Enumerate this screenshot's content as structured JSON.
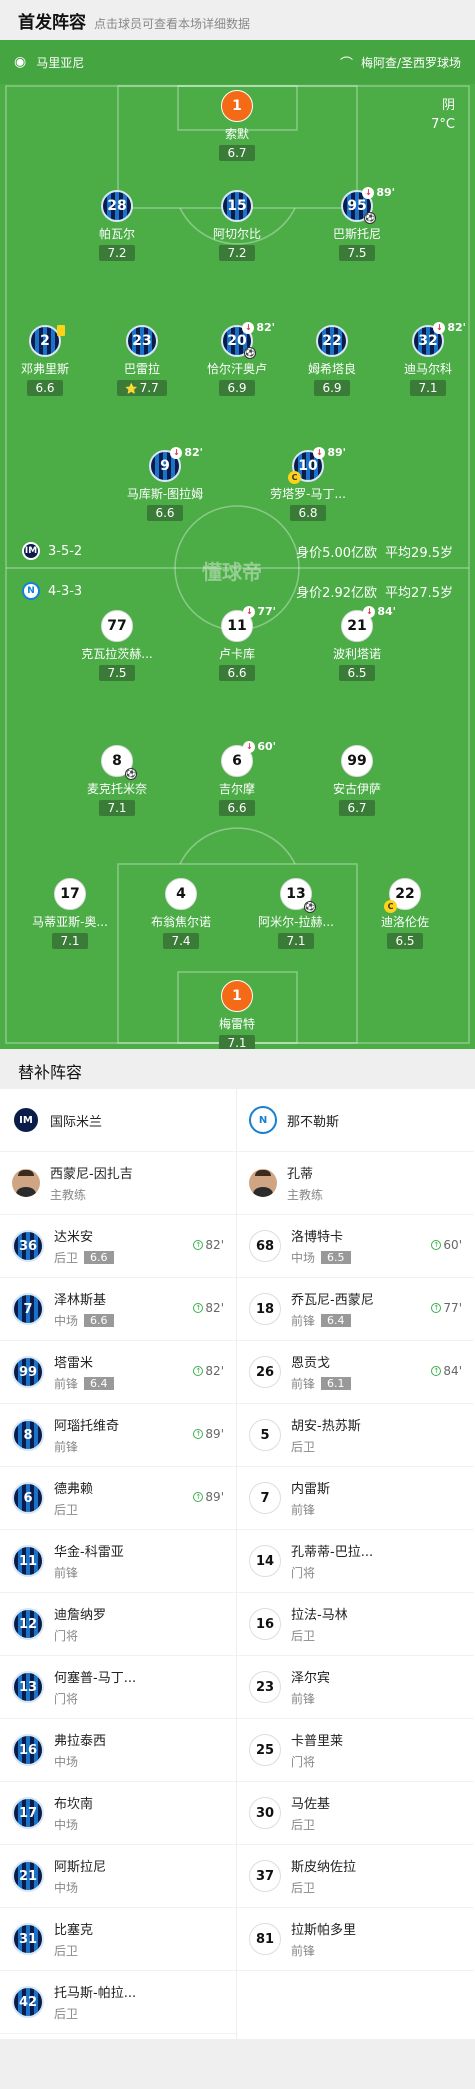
{
  "header": {
    "title": "首发阵容",
    "subtitle": "点击球员可查看本场详细数据"
  },
  "pitch": {
    "referee": "马里亚尼",
    "stadium": "梅阿查/圣西罗球场",
    "weather": "阴",
    "temperature": "7°C",
    "watermark": "懂球帝",
    "home": {
      "formation": "3-5-2",
      "value": "身价5.00亿欧",
      "avg_age": "平均29.5岁"
    },
    "away": {
      "formation": "4-3-3",
      "value": "身价2.92亿欧",
      "avg_age": "平均27.5岁"
    }
  },
  "players": [
    {
      "num": "1",
      "name": "索默",
      "rating": "6.7",
      "kit": "gk1"
    },
    {
      "num": "28",
      "name": "帕瓦尔",
      "rating": "7.2",
      "kit": "inter"
    },
    {
      "num": "15",
      "name": "阿切尔比",
      "rating": "7.2",
      "kit": "inter"
    },
    {
      "num": "95",
      "name": "巴斯托尼",
      "rating": "7.5",
      "kit": "inter",
      "sub_min": "89'"
    },
    {
      "num": "2",
      "name": "邓弗里斯",
      "rating": "6.6",
      "kit": "inter"
    },
    {
      "num": "23",
      "name": "巴雷拉",
      "rating": "7.7",
      "kit": "inter",
      "star": "⭐"
    },
    {
      "num": "20",
      "name": "恰尔汗奥卢",
      "rating": "6.9",
      "kit": "inter",
      "sub_min": "82'"
    },
    {
      "num": "22",
      "name": "姆希塔良",
      "rating": "6.9",
      "kit": "inter"
    },
    {
      "num": "32",
      "name": "迪马尔科",
      "rating": "7.1",
      "kit": "inter",
      "sub_min": "82'"
    },
    {
      "num": "9",
      "name": "马库斯-图拉姆",
      "rating": "6.6",
      "kit": "inter",
      "sub_min": "82'"
    },
    {
      "num": "10",
      "name": "劳塔罗-马丁...",
      "rating": "6.8",
      "kit": "inter",
      "sub_min": "89'"
    },
    {
      "num": "77",
      "name": "克瓦拉茨赫...",
      "rating": "7.5",
      "kit": "nap"
    },
    {
      "num": "11",
      "name": "卢卡库",
      "rating": "6.6",
      "kit": "nap",
      "sub_min": "77'"
    },
    {
      "num": "21",
      "name": "波利塔诺",
      "rating": "6.5",
      "kit": "nap",
      "sub_min": "84'"
    },
    {
      "num": "8",
      "name": "麦克托米奈",
      "rating": "7.1",
      "kit": "nap"
    },
    {
      "num": "6",
      "name": "吉尔摩",
      "rating": "6.6",
      "kit": "nap",
      "sub_min": "60'"
    },
    {
      "num": "99",
      "name": "安古伊萨",
      "rating": "6.7",
      "kit": "nap"
    },
    {
      "num": "17",
      "name": "马蒂亚斯-奥...",
      "rating": "7.1",
      "kit": "nap"
    },
    {
      "num": "4",
      "name": "布翁焦尔诺",
      "rating": "7.4",
      "kit": "nap"
    },
    {
      "num": "13",
      "name": "阿米尔-拉赫...",
      "rating": "7.1",
      "kit": "nap"
    },
    {
      "num": "22",
      "name": "迪洛伦佐",
      "rating": "6.5",
      "kit": "nap"
    },
    {
      "num": "1",
      "name": "梅雷特",
      "rating": "7.1",
      "kit": "gk1"
    }
  ],
  "subs": {
    "title": "替补阵容",
    "home_team": "国际米兰",
    "away_team": "那不勒斯",
    "home_coach": {
      "name": "西蒙尼-因扎吉",
      "role": "主教练"
    },
    "away_coach": {
      "name": "孔蒂",
      "role": "主教练"
    },
    "home": [
      {
        "num": "36",
        "name": "达米安",
        "pos": "后卫",
        "rating": "6.6",
        "min": "82'"
      },
      {
        "num": "7",
        "name": "泽林斯基",
        "pos": "中场",
        "rating": "6.6",
        "min": "82'"
      },
      {
        "num": "99",
        "name": "塔雷米",
        "pos": "前锋",
        "rating": "6.4",
        "min": "82'"
      },
      {
        "num": "8",
        "name": "阿瑙托维奇",
        "pos": "前锋",
        "min": "89'"
      },
      {
        "num": "6",
        "name": "德弗赖",
        "pos": "后卫",
        "min": "89'"
      },
      {
        "num": "11",
        "name": "华金-科雷亚",
        "pos": "前锋"
      },
      {
        "num": "12",
        "name": "迪詹纳罗",
        "pos": "门将"
      },
      {
        "num": "13",
        "name": "何塞普-马丁...",
        "pos": "门将"
      },
      {
        "num": "16",
        "name": "弗拉泰西",
        "pos": "中场"
      },
      {
        "num": "17",
        "name": "布坎南",
        "pos": "中场"
      },
      {
        "num": "21",
        "name": "阿斯拉尼",
        "pos": "中场"
      },
      {
        "num": "31",
        "name": "比塞克",
        "pos": "后卫"
      },
      {
        "num": "42",
        "name": "托马斯-帕拉...",
        "pos": "后卫"
      }
    ],
    "away": [
      {
        "num": "68",
        "name": "洛博特卡",
        "pos": "中场",
        "rating": "6.5",
        "min": "60'"
      },
      {
        "num": "18",
        "name": "乔瓦尼-西蒙尼",
        "pos": "前锋",
        "rating": "6.4",
        "min": "77'"
      },
      {
        "num": "26",
        "name": "恩贡戈",
        "pos": "前锋",
        "rating": "6.1",
        "min": "84'"
      },
      {
        "num": "5",
        "name": "胡安-热苏斯",
        "pos": "后卫"
      },
      {
        "num": "7",
        "name": "内雷斯",
        "pos": "前锋"
      },
      {
        "num": "14",
        "name": "孔蒂蒂-巴拉...",
        "pos": "门将"
      },
      {
        "num": "16",
        "name": "拉法-马林",
        "pos": "后卫"
      },
      {
        "num": "23",
        "name": "泽尔宾",
        "pos": "前锋"
      },
      {
        "num": "25",
        "name": "卡普里莱",
        "pos": "门将"
      },
      {
        "num": "30",
        "name": "马佐基",
        "pos": "后卫"
      },
      {
        "num": "37",
        "name": "斯皮纳佐拉",
        "pos": "后卫"
      },
      {
        "num": "81",
        "name": "拉斯帕多里",
        "pos": "前锋"
      }
    ]
  }
}
